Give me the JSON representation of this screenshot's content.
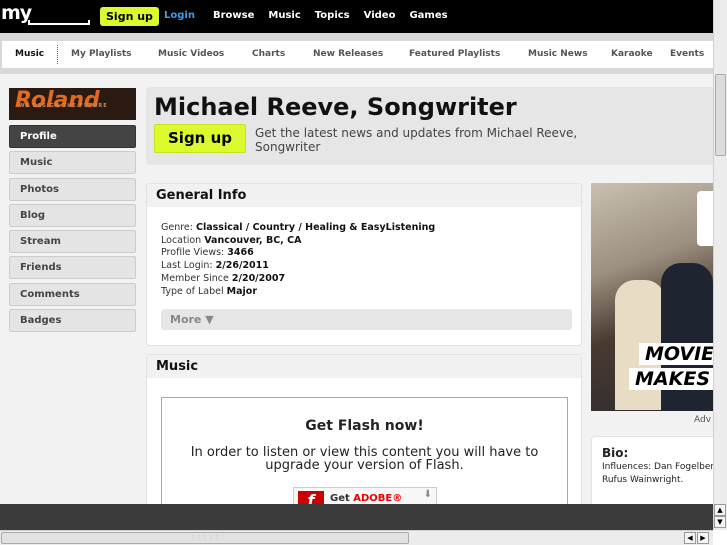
{
  "topbar": {
    "logo": "my",
    "signup": "Sign up",
    "login": "Login",
    "nav": [
      "Browse",
      "Music",
      "Topics",
      "Video",
      "Games"
    ]
  },
  "subnav": [
    "Music",
    "My Playlists",
    "Music Videos",
    "Charts",
    "New Releases",
    "Featured Playlists",
    "Music News",
    "Karaoke",
    "Events"
  ],
  "sponsor": {
    "name": "Roland",
    "tagline": "WE DESIGN THE FUTURE"
  },
  "sidebar": [
    "Profile",
    "Music",
    "Photos",
    "Blog",
    "Stream",
    "Friends",
    "Comments",
    "Badges"
  ],
  "header": {
    "title": "Michael Reeve, Songwriter",
    "signup": "Sign up",
    "tagline": "Get the latest news and updates from Michael Reeve, Songwriter"
  },
  "general_info": {
    "title": "General Info",
    "rows": [
      {
        "label": "Genre: ",
        "value": "Classical / Country / Healing & EasyListening"
      },
      {
        "label": "Location ",
        "value": "Vancouver, BC, CA"
      },
      {
        "label": "Profile Views: ",
        "value": "3466"
      },
      {
        "label": "Last Login: ",
        "value": "2/26/2011"
      },
      {
        "label": "Member Since ",
        "value": "2/20/2007"
      },
      {
        "label": "Type of Label ",
        "value": "Major"
      }
    ],
    "more": "More ▼"
  },
  "music": {
    "title": "Music",
    "flash_title": "Get Flash now!",
    "flash_text": "In order to listen or view this content you will have to upgrade your version of Flash.",
    "get": "Get ",
    "adobe": "ADOBE®"
  },
  "ad": {
    "line1": "MOVIE",
    "line2": "MAKES",
    "label": "Adv"
  },
  "bio": {
    "title": "Bio:",
    "line1": "Influences: Dan Fogelberg",
    "line2": "Rufus Wainwright."
  }
}
